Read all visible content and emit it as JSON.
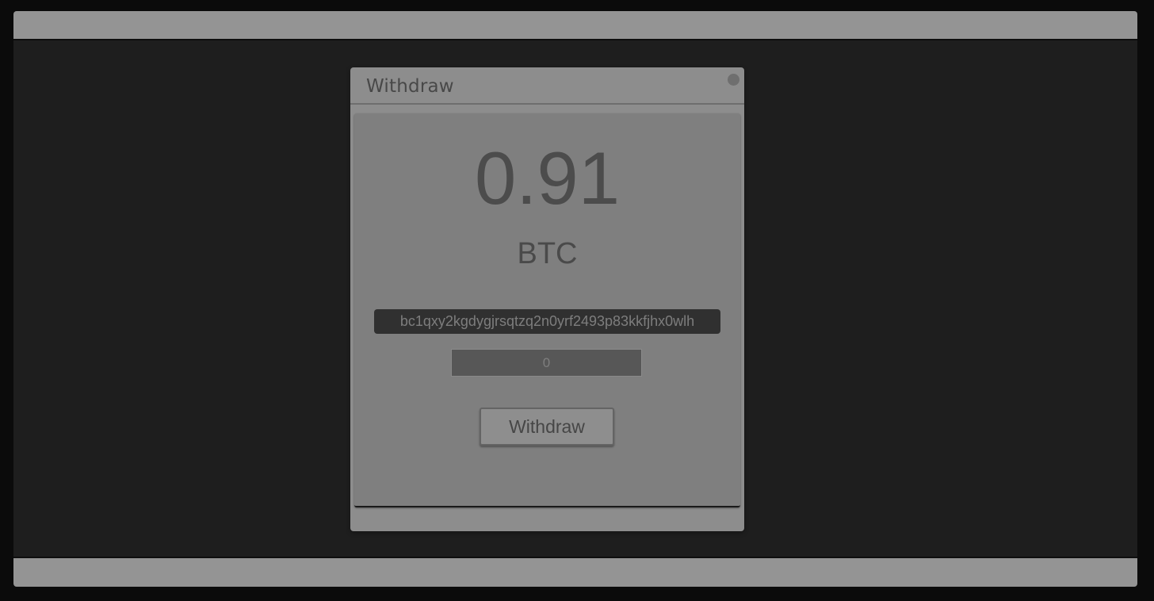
{
  "dialog": {
    "title": "Withdraw",
    "amount": "0.91",
    "currency": "BTC",
    "address": "bc1qxy2kgdygjrsqtzq2n0yrf2493p83kkfjhx0wlh",
    "amount_input": {
      "value": "",
      "placeholder": "0"
    },
    "withdraw_button_label": "Withdraw"
  },
  "colors": {
    "background": "#1e1e1e",
    "bar": "#949494",
    "modal": "#8d8d8d",
    "modal_body": "#7f7f7f",
    "address_bg": "#303030"
  },
  "icons": {
    "close": "close-dot-icon"
  }
}
